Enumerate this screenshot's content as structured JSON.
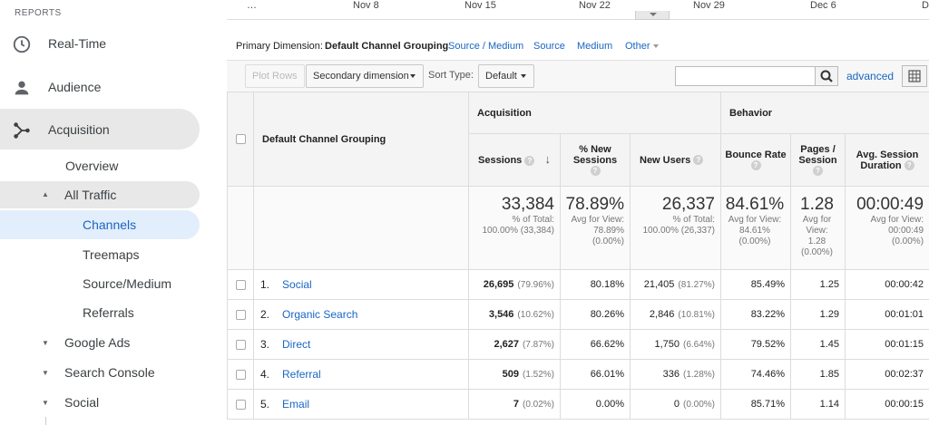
{
  "sidebar": {
    "section_label": "REPORTS",
    "main_items": [
      {
        "label": "Real-Time",
        "icon": "clock-icon"
      },
      {
        "label": "Audience",
        "icon": "person-icon"
      },
      {
        "label": "Acquisition",
        "icon": "acquisition-icon"
      }
    ],
    "acquisition_sub": {
      "overview": "Overview",
      "all_traffic": "All Traffic",
      "channels": "Channels",
      "treemaps": "Treemaps",
      "source_medium": "Source/Medium",
      "referrals": "Referrals",
      "google_ads": "Google Ads",
      "search_console": "Search Console",
      "social": "Social"
    }
  },
  "timeline": {
    "labels": [
      "…",
      "Nov 8",
      "Nov 15",
      "Nov 22",
      "Nov 29",
      "Dec 6",
      "D"
    ]
  },
  "primary_dimension": {
    "label": "Primary Dimension:",
    "active": "Default Channel Grouping",
    "options": [
      "Source / Medium",
      "Source",
      "Medium",
      "Other"
    ]
  },
  "toolbar": {
    "plot_rows": "Plot Rows",
    "secondary_dimension": "Secondary dimension",
    "sort_type_label": "Sort Type:",
    "sort_type_value": "Default",
    "search_value": "",
    "advanced": "advanced"
  },
  "table": {
    "dimension_header": "Default Channel Grouping",
    "groups": {
      "acquisition": "Acquisition",
      "behavior": "Behavior"
    },
    "columns": {
      "sessions": "Sessions",
      "new_sessions": "% New Sessions",
      "new_users": "New Users",
      "bounce_rate": "Bounce Rate",
      "pages_session": "Pages / Session",
      "avg_session_duration": "Avg. Session Duration"
    },
    "totals": {
      "sessions": {
        "value": "33,384",
        "line1": "% of Total:",
        "line2": "100.00% (33,384)"
      },
      "new_sessions": {
        "value": "78.89%",
        "line1": "Avg for View:",
        "line2": "78.89%",
        "line3": "(0.00%)"
      },
      "new_users": {
        "value": "26,337",
        "line1": "% of Total:",
        "line2": "100.00% (26,337)"
      },
      "bounce_rate": {
        "value": "84.61%",
        "line1": "Avg for View:",
        "line2": "84.61%",
        "line3": "(0.00%)"
      },
      "pages_session": {
        "value": "1.28",
        "line1": "Avg for",
        "line2": "View:",
        "line3": "1.28",
        "line4": "(0.00%)"
      },
      "avg_session_duration": {
        "value": "00:00:49",
        "line1": "Avg for View:",
        "line2": "00:00:49",
        "line3": "(0.00%)"
      }
    },
    "rows": [
      {
        "num": "1.",
        "channel": "Social",
        "sessions": "26,695",
        "sessions_pct": "(79.96%)",
        "new_sessions": "80.18%",
        "new_users": "21,405",
        "new_users_pct": "(81.27%)",
        "bounce": "85.49%",
        "pages": "1.25",
        "duration": "00:00:42"
      },
      {
        "num": "2.",
        "channel": "Organic Search",
        "sessions": "3,546",
        "sessions_pct": "(10.62%)",
        "new_sessions": "80.26%",
        "new_users": "2,846",
        "new_users_pct": "(10.81%)",
        "bounce": "83.22%",
        "pages": "1.29",
        "duration": "00:01:01"
      },
      {
        "num": "3.",
        "channel": "Direct",
        "sessions": "2,627",
        "sessions_pct": "(7.87%)",
        "new_sessions": "66.62%",
        "new_users": "1,750",
        "new_users_pct": "(6.64%)",
        "bounce": "79.52%",
        "pages": "1.45",
        "duration": "00:01:15"
      },
      {
        "num": "4.",
        "channel": "Referral",
        "sessions": "509",
        "sessions_pct": "(1.52%)",
        "new_sessions": "66.01%",
        "new_users": "336",
        "new_users_pct": "(1.28%)",
        "bounce": "74.46%",
        "pages": "1.85",
        "duration": "00:02:37"
      },
      {
        "num": "5.",
        "channel": "Email",
        "sessions": "7",
        "sessions_pct": "(0.02%)",
        "new_sessions": "0.00%",
        "new_users": "0",
        "new_users_pct": "(0.00%)",
        "bounce": "85.71%",
        "pages": "1.14",
        "duration": "00:00:15"
      }
    ]
  },
  "colors": {
    "link": "#1a66c2",
    "selected_bg": "#e3eefc",
    "hover_bg": "#e8e8e8"
  }
}
